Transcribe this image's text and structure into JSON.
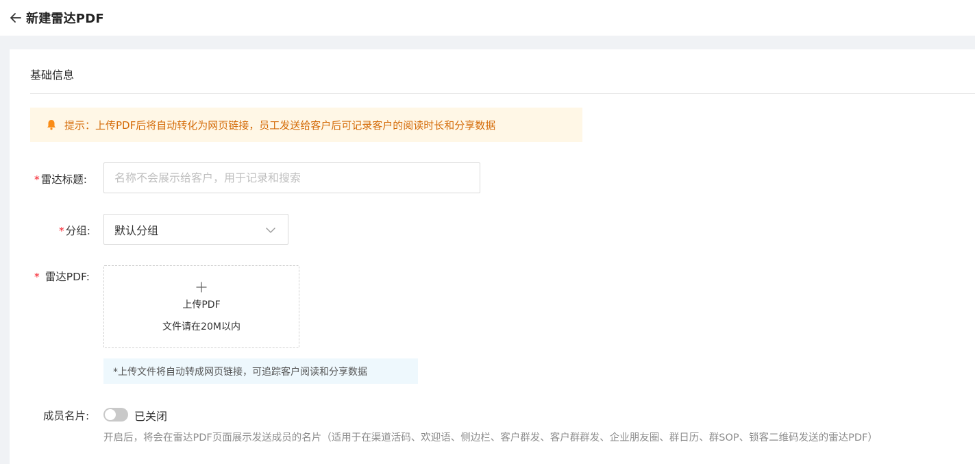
{
  "header": {
    "back_icon": "arrow-left-icon",
    "title": "新建雷达PDF"
  },
  "section": {
    "title": "基础信息"
  },
  "notice": {
    "icon": "bell-icon",
    "color": "#d46b08",
    "background": "#fff7e6",
    "text": "提示：上传PDF后将自动转化为网页链接，员工发送给客户后可记录客户的阅读时长和分享数据"
  },
  "form": {
    "required_mark": "*",
    "radar_title": {
      "label": "雷达标题:",
      "placeholder": "名称不会展示给客户，用于记录和搜索",
      "value": ""
    },
    "group": {
      "label": "分组:",
      "selected": "默认分组",
      "icon": "chevron-down-icon"
    },
    "radar_pdf": {
      "label": "雷达PDF:",
      "upload_icon": "plus-icon",
      "upload_label": "上传PDF",
      "upload_hint": "文件请在20M以内",
      "tip": "*上传文件将自动转成网页链接，可追踪客户阅读和分享数据"
    },
    "member_card": {
      "label": "成员名片:",
      "toggle_on": false,
      "status": "已关闭",
      "description": "开启后，将会在雷达PDF页面展示发送成员的名片（适用于在渠道活码、欢迎语、侧边栏、客户群发、客户群群发、企业朋友圈、群日历、群SOP、锁客二维码发送的雷达PDF）"
    }
  },
  "colors": {
    "required": "#f5222d",
    "toggle_off": "#c9c9c9",
    "tip_bg": "#eef8fd"
  }
}
